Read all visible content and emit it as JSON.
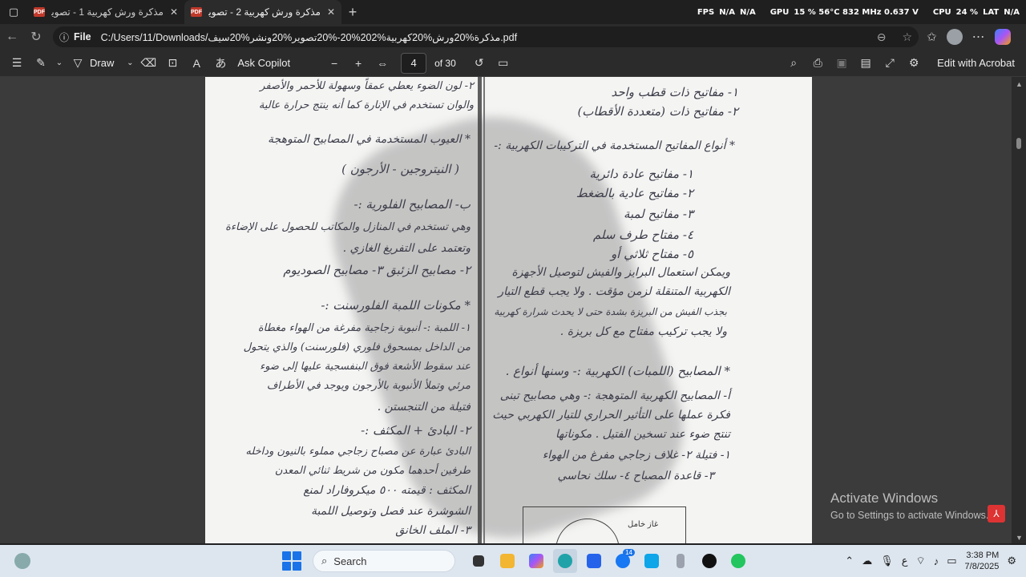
{
  "browser": {
    "tabs": [
      {
        "title": "مذكرة ورش كهربية 1 - تصوير ونشر",
        "active": false
      },
      {
        "title": "مذكرة ورش كهربية 2 - تصوير ونشر",
        "active": true
      }
    ],
    "overlay": {
      "fps_label": "FPS",
      "fps_val1": "N/A",
      "fps_val2": "N/A",
      "gpu_label": "GPU",
      "gpu_val": "15 % 56°C 832 MHz 0.637 V",
      "cpu_label": "CPU",
      "cpu_val": "24 %",
      "lat_label": "LAT",
      "lat_val": "N/A"
    },
    "address": {
      "scheme_label": "File",
      "url": "C:/Users/11/Downloads/مذكرة%20ورش%20كهربية%202%20-%20تصوير%20ونشر%20سيف.pdf"
    }
  },
  "pdf_toolbar": {
    "draw_label": "Draw",
    "copilot_label": "Ask Copilot",
    "page_current": "4",
    "page_total": "of 30",
    "acrobat_label": "Edit with Acrobat"
  },
  "document": {
    "right_col": [
      "١- مفاتيح ذات قطب واحد",
      "٢- مفاتيح ذات (متعددة الأقطاب)",
      "* أنواع المفاتيح المستخدمة في التركيبات الكهربية :-",
      "١- مفاتيح عادة دائرية",
      "٢- مفاتيح عادية بالضغط",
      "٣- مفاتيح لمبة",
      "٤- مفتاح طرف سلم",
      "٥- مفتاح ثلاثي أو",
      "ويمكن استعمال البرايز والفيش لتوصيل الأجهزة",
      "الكهربية المتنقلة لزمن مؤقت . ولا يجب قطع التيار",
      "بجذب الفيش من البريزة بشدة حتى لا يحدث شرارة كهربية",
      "ولا يجب تركيب مفتاح مع كل بريزة .",
      "* المصابيح (اللمبات) الكهربية :- وسنها أنواع .",
      "أ- المصابيح الكهربية المتوهجة :- وهي مصابيح تبنى",
      "فكرة عملها على التأثير الحراري للتيار الكهربي حيث",
      "تنتج ضوء عند تسخين الفتيل . مكوناتها",
      "١- فتيلة    ٢- غلاف زجاجي مفرغ من الهواء",
      "٣- قاعدة المصباح    ٤- سلك نحاسي"
    ],
    "left_col": [
      "٢- لون الضوء يعطي عمقاً وسهولة للأحمر والأصفر",
      "والوان تستخدم في الإنارة كما أنه ينتج حرارة عالية",
      "* العيوب المستخدمة في المصابيح المتوهجة",
      "( النيتروجين - الأرجون )",
      "ب- المصابيح الفلورية :-",
      "وهي تستخدم في المنازل والمكاتب للحصول على الإضاءة",
      "وتعتمد على التفريغ الغازي .",
      "٢- مصابيح الزئبق    ٣- مصابيح الصوديوم",
      "* مكونات اللمبة الفلورسنت :-",
      "١- اللمبة :- أنبوبة زجاجية مفرغة من الهواء مغطاة",
      "من الداخل بمسحوق فلوري (فلورسنت) والذي يتحول",
      "عند سقوط الأشعة فوق البنفسجية عليها إلى ضوء",
      "مرئي وتملأ الأنبوبة بالأرجون ويوجد في الأطراف",
      "فتيلة من التنجستن .",
      "٢- البادئ + المكثف :-",
      "البادئ عبارة عن مصباح زجاجي مملوء بالنيون وداخله",
      "طرفين أحدهما مكون من شريط ثنائي المعدن",
      "المكثف : قيمته ٥٠٠ ميكروفاراد لمنع",
      "الشوشرة عند فصل وتوصيل اللمبة",
      "٣- الملف الخانق"
    ],
    "diagram_label": "غاز خامل"
  },
  "watermark": {
    "title": "Activate Windows",
    "subtitle": "Go to Settings to activate Windows."
  },
  "taskbar": {
    "search_label": "Search",
    "facebook_badge": "14",
    "lang": "ع",
    "time": "3:38 PM",
    "date": "7/8/2025"
  }
}
